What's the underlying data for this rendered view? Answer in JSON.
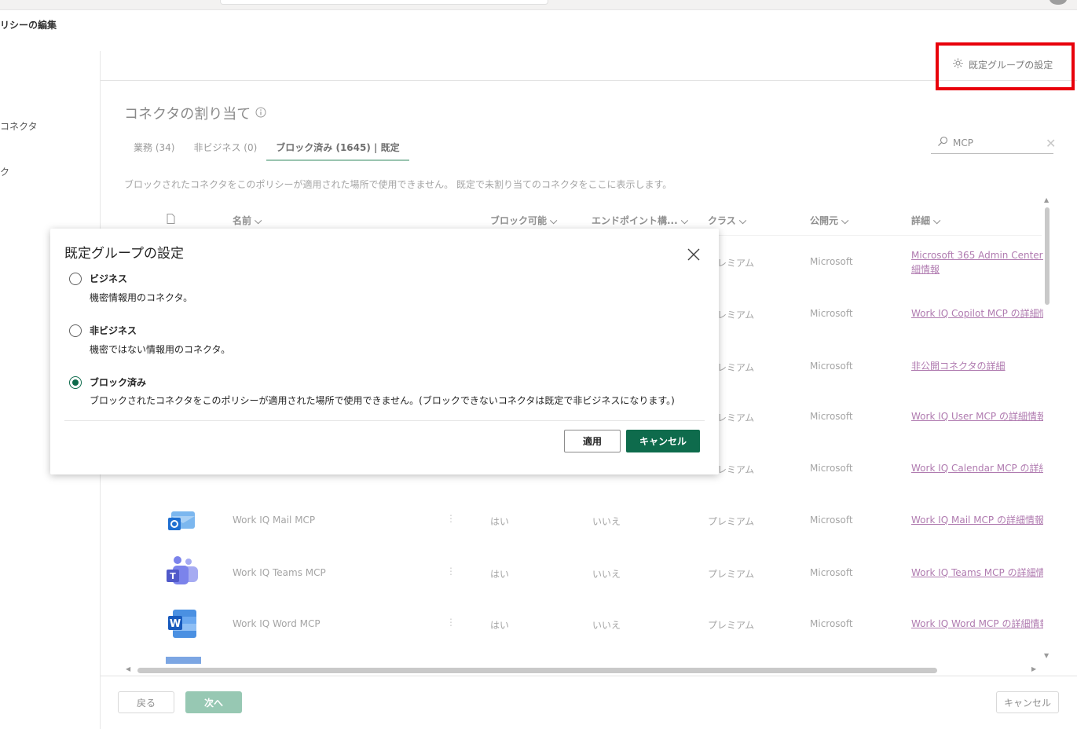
{
  "header": {
    "page_title": "リシーの編集"
  },
  "leftnav": {
    "items": [
      "コネクタ",
      "ク"
    ]
  },
  "commandbar": {
    "default_group_label": "既定グループの設定"
  },
  "section": {
    "title": "コネクタの割り当て",
    "tabs": [
      {
        "label": "業務 (34)"
      },
      {
        "label": "非ビジネス (0)"
      },
      {
        "label": "ブロック済み (1645) | 既定"
      }
    ],
    "description": "ブロックされたコネクタをこのポリシーが適用された場所で使用できません。 既定で未割り当てのコネクタをここに表示します。"
  },
  "search": {
    "value": "MCP"
  },
  "table": {
    "columns": {
      "name": "名前 ⌵",
      "blockable": "ブロック可能 ⌵",
      "endpoint": "エンドポイント構... ⌵",
      "class": "クラス ⌵",
      "publisher": "公開元 ⌵",
      "details": "詳細 ⌵"
    },
    "partial_rows": [
      {
        "class": "レミアム",
        "publisher": "Microsoft",
        "details": "Microsoft 365 Admin Center M",
        "details2": "細情報"
      },
      {
        "class": "レミアム",
        "publisher": "Microsoft",
        "details": "Work IQ Copilot MCP の詳細情"
      },
      {
        "class": "レミアム",
        "publisher": "Microsoft",
        "details": "非公開コネクタの詳細"
      },
      {
        "class": "レミアム",
        "publisher": "Microsoft",
        "details": "Work IQ User MCP の詳細情報"
      },
      {
        "class": "レミアム",
        "publisher": "Microsoft",
        "details": "Work IQ Calendar MCP の詳細"
      }
    ],
    "rows": [
      {
        "name": "Work IQ Mail MCP",
        "blockable": "はい",
        "endpoint": "いいえ",
        "class": "プレミアム",
        "publisher": "Microsoft",
        "details": "Work IQ Mail MCP の詳細情報"
      },
      {
        "name": "Work IQ Teams MCP",
        "blockable": "はい",
        "endpoint": "いいえ",
        "class": "プレミアム",
        "publisher": "Microsoft",
        "details": "Work IQ Teams MCP の詳細情"
      },
      {
        "name": "Work IQ Word MCP",
        "blockable": "はい",
        "endpoint": "いいえ",
        "class": "プレミアム",
        "publisher": "Microsoft",
        "details": "Work IQ Word MCP の詳細情報"
      }
    ]
  },
  "footer": {
    "back_label": "戻る",
    "next_label": "次へ",
    "cancel_label": "キャンセル"
  },
  "dialog": {
    "title": "既定グループの設定",
    "options": [
      {
        "label": "ビジネス",
        "desc": "機密情報用のコネクタ。",
        "checked": false
      },
      {
        "label": "非ビジネス",
        "desc": "機密ではない情報用のコネクタ。",
        "checked": false
      },
      {
        "label": "ブロック済み",
        "desc": "ブロックされたコネクタをこのポリシーが適用された場所で使用できません。(ブロックできないコネクタは既定で非ビジネスになります。)",
        "checked": true
      }
    ],
    "apply_label": "適用",
    "cancel_label": "キャンセル"
  },
  "colors": {
    "accent": "#0e6b4c",
    "highlight": "#e8000b",
    "link": "#b07bb0"
  }
}
